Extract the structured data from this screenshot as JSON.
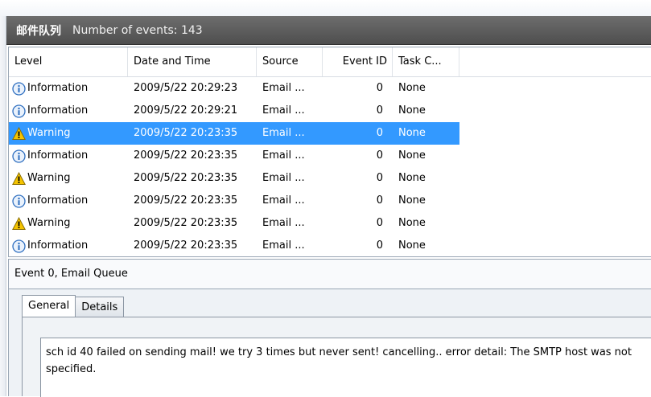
{
  "header": {
    "title": "邮件队列",
    "event_count": "Number of events: 143"
  },
  "columns": [
    "Level",
    "Date and Time",
    "Source",
    "Event ID",
    "Task C..."
  ],
  "events": [
    {
      "level": "Information",
      "icon": "info-icon",
      "date": "2009/5/22 20:29:23",
      "source": "Email ...",
      "event_id": "0",
      "task": "None",
      "selected": false
    },
    {
      "level": "Information",
      "icon": "info-icon",
      "date": "2009/5/22 20:29:21",
      "source": "Email ...",
      "event_id": "0",
      "task": "None",
      "selected": false
    },
    {
      "level": "Warning",
      "icon": "warning-icon",
      "date": "2009/5/22 20:23:35",
      "source": "Email ...",
      "event_id": "0",
      "task": "None",
      "selected": true
    },
    {
      "level": "Information",
      "icon": "info-icon",
      "date": "2009/5/22 20:23:35",
      "source": "Email ...",
      "event_id": "0",
      "task": "None",
      "selected": false
    },
    {
      "level": "Warning",
      "icon": "warning-icon",
      "date": "2009/5/22 20:23:35",
      "source": "Email ...",
      "event_id": "0",
      "task": "None",
      "selected": false
    },
    {
      "level": "Information",
      "icon": "info-icon",
      "date": "2009/5/22 20:23:35",
      "source": "Email ...",
      "event_id": "0",
      "task": "None",
      "selected": false
    },
    {
      "level": "Warning",
      "icon": "warning-icon",
      "date": "2009/5/22 20:23:35",
      "source": "Email ...",
      "event_id": "0",
      "task": "None",
      "selected": false
    },
    {
      "level": "Information",
      "icon": "info-icon",
      "date": "2009/5/22 20:23:35",
      "source": "Email ...",
      "event_id": "0",
      "task": "None",
      "selected": false
    }
  ],
  "detail": {
    "title": "Event 0, Email Queue",
    "tabs": [
      {
        "label": "General",
        "active": true
      },
      {
        "label": "Details",
        "active": false
      }
    ],
    "message": "sch id 40 failed on sending mail! we try 3 times but never sent! cancelling.. error detail: The SMTP host was not specified."
  },
  "colors": {
    "selection": "#3399ff",
    "header_bg": "#5e5e5e",
    "info_blue": "#2f6fc0",
    "warning_yellow": "#f5c400"
  }
}
